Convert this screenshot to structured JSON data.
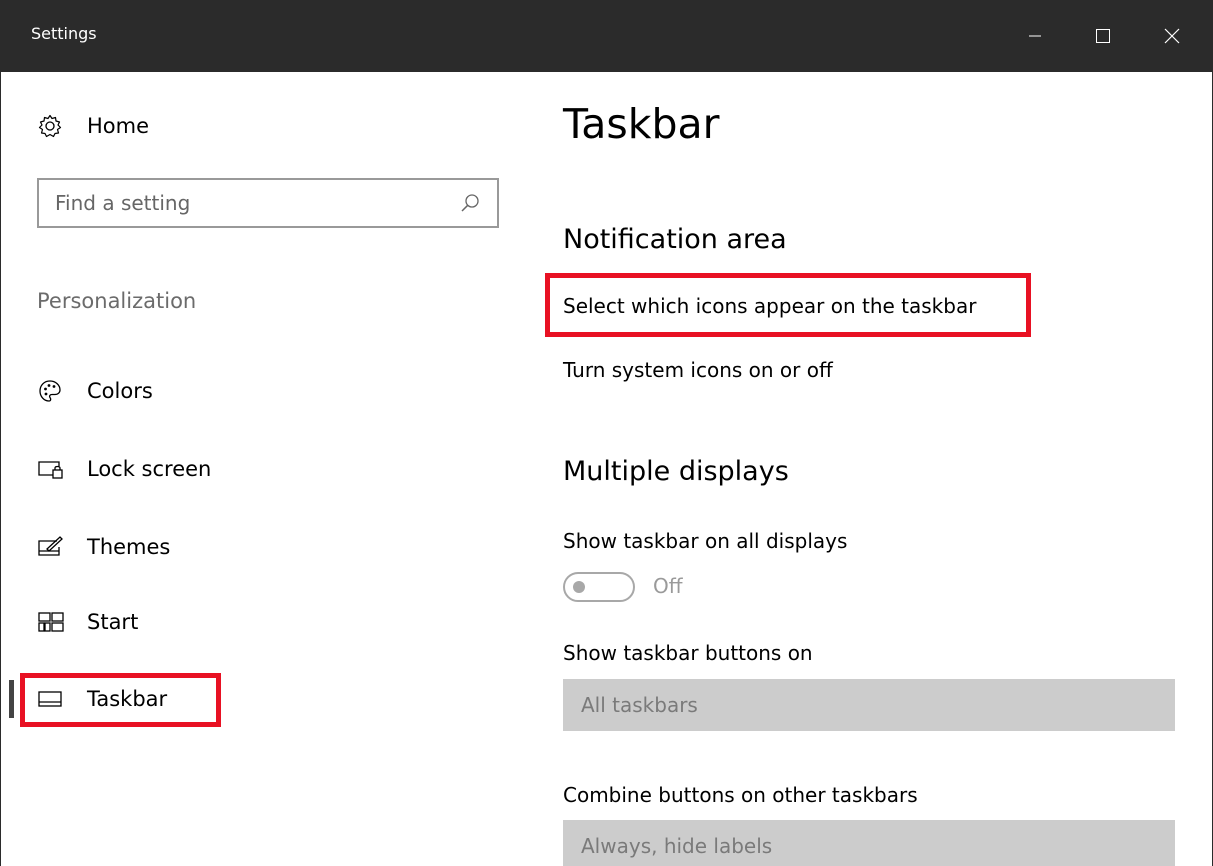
{
  "window": {
    "title": "Settings",
    "controls": [
      "minimize-icon",
      "maximize-icon",
      "close-icon"
    ]
  },
  "sidebar": {
    "home": {
      "label": "Home",
      "icon": "gear-icon"
    },
    "search": {
      "placeholder": "Find a setting",
      "icon": "search-icon"
    },
    "section": "Personalization",
    "items": [
      {
        "label": "Colors",
        "icon": "palette-icon"
      },
      {
        "label": "Lock screen",
        "icon": "lock-screen-icon"
      },
      {
        "label": "Themes",
        "icon": "themes-icon"
      },
      {
        "label": "Start",
        "icon": "start-icon"
      },
      {
        "label": "Taskbar",
        "icon": "taskbar-icon",
        "selected": true
      }
    ]
  },
  "main": {
    "title": "Taskbar",
    "notification_area": {
      "heading": "Notification area",
      "link_icons": "Select which icons appear on the taskbar",
      "link_system": "Turn system icons on or off"
    },
    "multiple_displays": {
      "heading": "Multiple displays",
      "show_all_label": "Show taskbar on all displays",
      "toggle_state": "Off",
      "show_buttons_label": "Show taskbar buttons on",
      "show_buttons_value": "All taskbars",
      "combine_label": "Combine buttons on other taskbars",
      "combine_value": "Always, hide labels"
    }
  },
  "colors": {
    "titlebar": "#2b2b2b",
    "highlight": "#e81123",
    "disabled_text": "#9a9a9a",
    "dropdown_bg": "#cccccc"
  }
}
